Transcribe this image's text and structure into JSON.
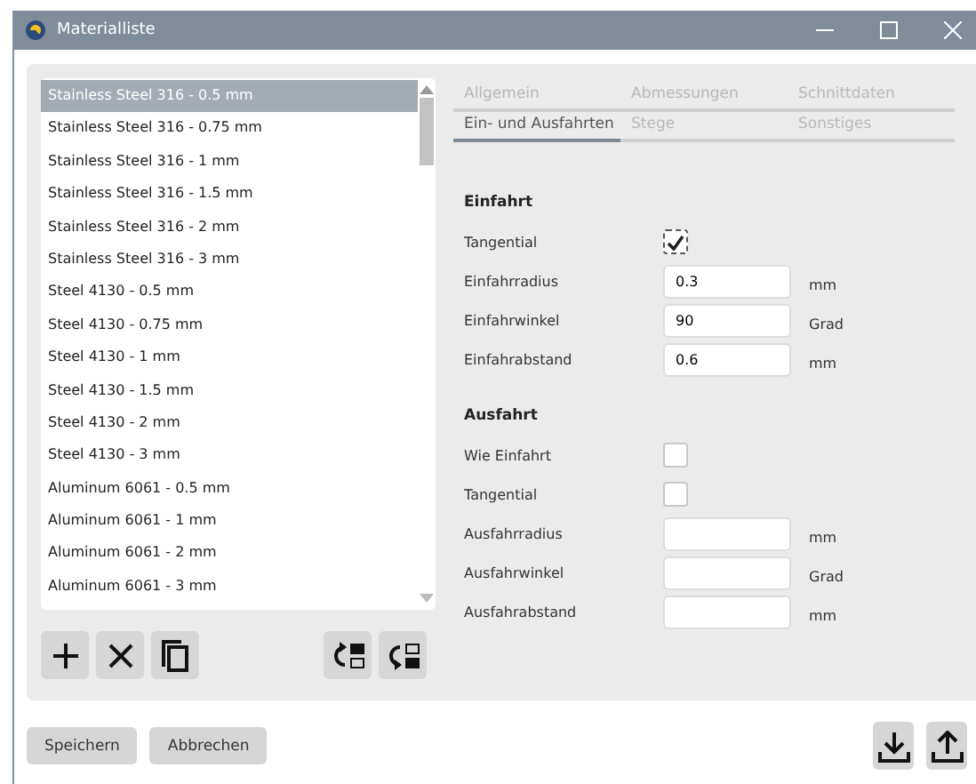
{
  "window": {
    "title": "Materialliste"
  },
  "materials": [
    {
      "label": "Stainless Steel 316 - 0.5 mm",
      "selected": true
    },
    {
      "label": "Stainless Steel 316 - 0.75 mm",
      "selected": false
    },
    {
      "label": "Stainless Steel 316 - 1 mm",
      "selected": false
    },
    {
      "label": "Stainless Steel 316 - 1.5 mm",
      "selected": false
    },
    {
      "label": "Stainless Steel 316 - 2 mm",
      "selected": false
    },
    {
      "label": "Stainless Steel 316 - 3 mm",
      "selected": false
    },
    {
      "label": "Steel 4130 - 0.5 mm",
      "selected": false
    },
    {
      "label": "Steel 4130 - 0.75 mm",
      "selected": false
    },
    {
      "label": "Steel 4130 - 1 mm",
      "selected": false
    },
    {
      "label": "Steel 4130 - 1.5 mm",
      "selected": false
    },
    {
      "label": "Steel 4130 - 2 mm",
      "selected": false
    },
    {
      "label": "Steel 4130 - 3 mm",
      "selected": false
    },
    {
      "label": "Aluminum 6061 - 0.5 mm",
      "selected": false
    },
    {
      "label": "Aluminum 6061 - 1 mm",
      "selected": false
    },
    {
      "label": "Aluminum 6061 - 2 mm",
      "selected": false
    },
    {
      "label": "Aluminum 6061 - 3 mm",
      "selected": false
    }
  ],
  "tab_rows": [
    [
      {
        "label": "Allgemein",
        "selected": false
      },
      {
        "label": "Abmessungen",
        "selected": false
      },
      {
        "label": "Schnittdaten",
        "selected": false
      }
    ],
    [
      {
        "label": "Ein- und Ausfahrten",
        "selected": true
      },
      {
        "label": "Stege",
        "selected": false
      },
      {
        "label": "Sonstiges",
        "selected": false
      }
    ]
  ],
  "form": [
    {
      "kind": "header",
      "label": "Einfahrt"
    },
    {
      "kind": "checkbox",
      "label": "Tangential",
      "checked": true
    },
    {
      "kind": "input",
      "label": "Einfahrradius",
      "value": "0.3",
      "unit": "mm"
    },
    {
      "kind": "input",
      "label": "Einfahrwinkel",
      "value": "90",
      "unit": "Grad"
    },
    {
      "kind": "input",
      "label": "Einfahrabstand",
      "value": "0.6",
      "unit": "mm"
    },
    {
      "kind": "header",
      "label": "Ausfahrt"
    },
    {
      "kind": "checkbox",
      "label": "Wie Einfahrt",
      "checked": false
    },
    {
      "kind": "checkbox",
      "label": "Tangential",
      "checked": false
    },
    {
      "kind": "input",
      "label": "Ausfahrradius",
      "unit": "mm"
    },
    {
      "kind": "input",
      "label": "Ausfahrwinkel",
      "unit": "Grad"
    },
    {
      "kind": "input",
      "label": "Ausfahrabstand",
      "unit": "mm"
    }
  ],
  "buttons": [
    "Speichern",
    "Abbrechen"
  ]
}
